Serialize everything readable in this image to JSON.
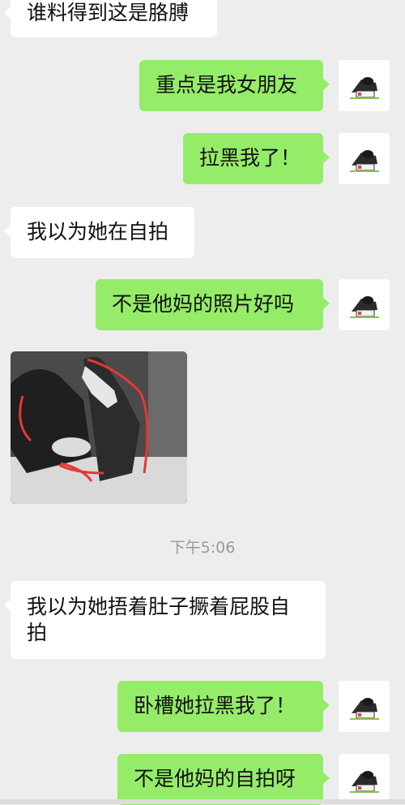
{
  "messages": [
    {
      "dir": "in",
      "text": "谁料得到这是胳膊"
    },
    {
      "dir": "out",
      "text": "重点是我女朋友"
    },
    {
      "dir": "out",
      "text": "拉黑我了！"
    },
    {
      "dir": "in",
      "text": "我以为她在自拍"
    },
    {
      "dir": "out",
      "text": "不是他妈的照片好吗"
    },
    {
      "dir": "in",
      "type": "image",
      "description_icon": "photo-icon"
    },
    {
      "dir": "in",
      "text": "我以为她捂着肚子撅着屁股自拍"
    },
    {
      "dir": "out",
      "text": "卧槽她拉黑我了！"
    },
    {
      "dir": "out",
      "text": "不是他妈的自拍呀"
    }
  ],
  "timestamp": "下午5:06",
  "colors": {
    "background": "#ededed",
    "outgoing": "#95ec69",
    "incoming": "#ffffff"
  },
  "avatar_icon": "cat-house-avatar-icon"
}
